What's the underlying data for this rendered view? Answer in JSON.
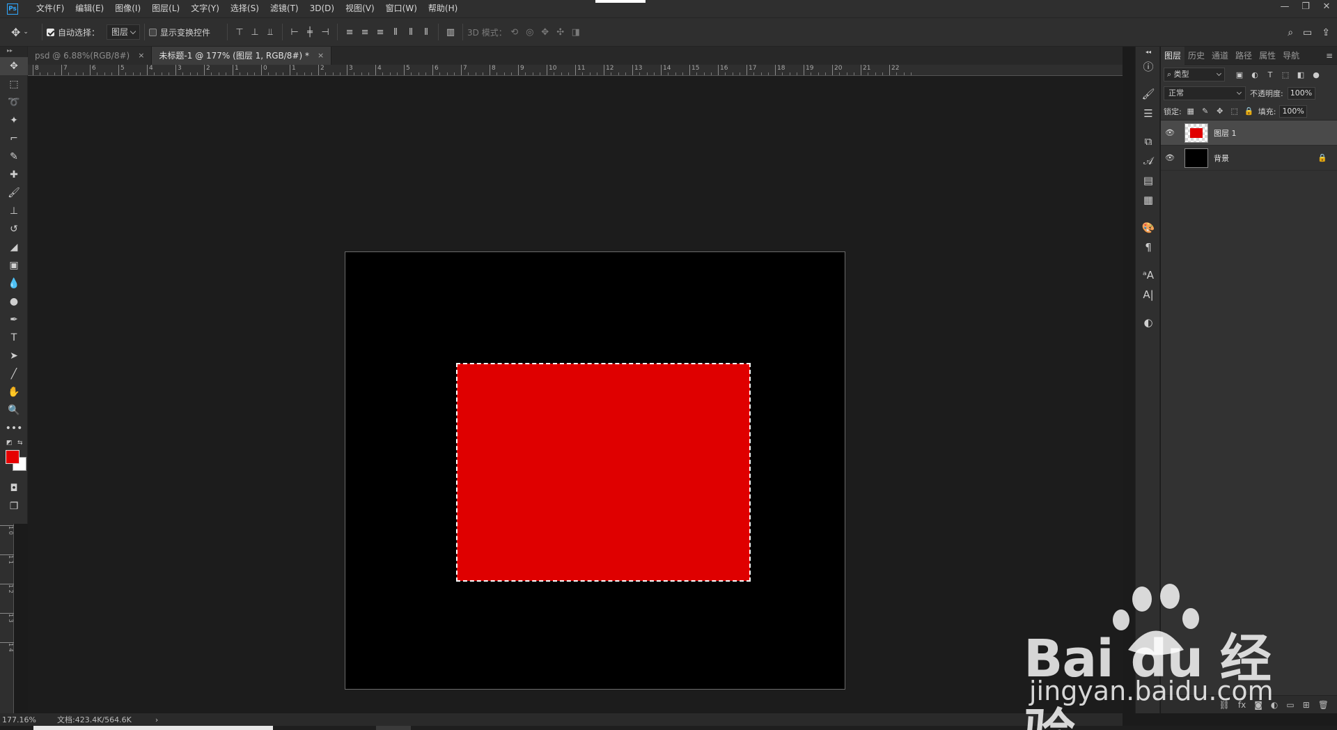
{
  "app": {
    "logo": "Ps"
  },
  "menu": [
    "文件(F)",
    "编辑(E)",
    "图像(I)",
    "图层(L)",
    "文字(Y)",
    "选择(S)",
    "滤镜(T)",
    "3D(D)",
    "视图(V)",
    "窗口(W)",
    "帮助(H)"
  ],
  "window_buttons": [
    "—",
    "❐",
    "✕"
  ],
  "options": {
    "auto_select_label": "自动选择：",
    "auto_select_checked": true,
    "auto_select_target": "图层",
    "show_transform_label": "显示变换控件",
    "show_transform_checked": false,
    "mode_3d_label": "3D 模式："
  },
  "tabs": [
    {
      "title": "psd @ 6.88%(RGB/8#)",
      "close": "×",
      "active": false
    },
    {
      "title": "未标题-1 @ 177% (图层 1, RGB/8#) *",
      "close": "×",
      "active": true
    }
  ],
  "ruler": {
    "top_labels": [
      "8",
      "7",
      "6",
      "5",
      "4",
      "3",
      "2",
      "1",
      "0",
      "1",
      "2",
      "3",
      "4",
      "5",
      "6",
      "7",
      "8",
      "9",
      "10",
      "11",
      "12",
      "13",
      "14",
      "15",
      "16",
      "17",
      "18",
      "19",
      "20",
      "21",
      "22"
    ],
    "left_labels": [
      "1 0",
      "1 1",
      "1 2",
      "1 3",
      "1 4"
    ]
  },
  "colors": {
    "foreground": "#e60000",
    "background": "#ffffff",
    "layer_fill": "#df0000",
    "canvas": "#000000"
  },
  "status": {
    "zoom": "177.16%",
    "doc": "文档:423.4K/564.6K",
    "arrow": "›"
  },
  "panel": {
    "tabs": [
      "图层",
      "历史",
      "通道",
      "路径",
      "属性",
      "导航"
    ],
    "active_tab": "图层",
    "filter_kind": "类型",
    "blend_mode": "正常",
    "opacity_label": "不透明度:",
    "opacity_value": "100%",
    "lock_label": "锁定:",
    "fill_label": "填充:",
    "fill_value": "100%",
    "layers": [
      {
        "name": "图层 1",
        "visible": true,
        "selected": true,
        "locked": false
      },
      {
        "name": "背景",
        "visible": true,
        "selected": false,
        "locked": true
      }
    ]
  },
  "watermark": {
    "brand": "Bai du 经验",
    "url": "jingyan.baidu.com"
  }
}
